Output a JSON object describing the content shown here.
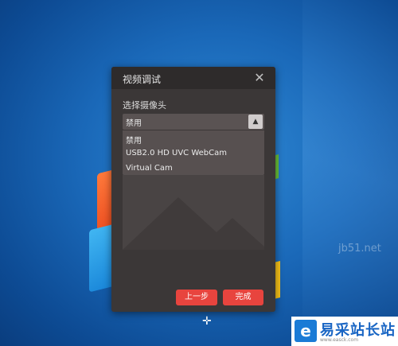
{
  "dialog": {
    "title": "视频调试",
    "close_icon": "close-icon",
    "camera_label": "选择摄像头",
    "camera_select": {
      "selected": "禁用",
      "options": [
        "禁用",
        "USB2.0 HD UVC WebCam",
        "Virtual Cam"
      ]
    },
    "buttons": {
      "prev": "上一步",
      "done": "完成"
    }
  },
  "desktop": {
    "watermark_text": "jb51.net",
    "badge_letter": "e",
    "badge_title": "易采站长站",
    "badge_sub": "www.easck.com"
  },
  "colors": {
    "accent": "#e8443e",
    "dialog_bg": "#3b3737",
    "titlebar_bg": "#2e2b2b"
  }
}
